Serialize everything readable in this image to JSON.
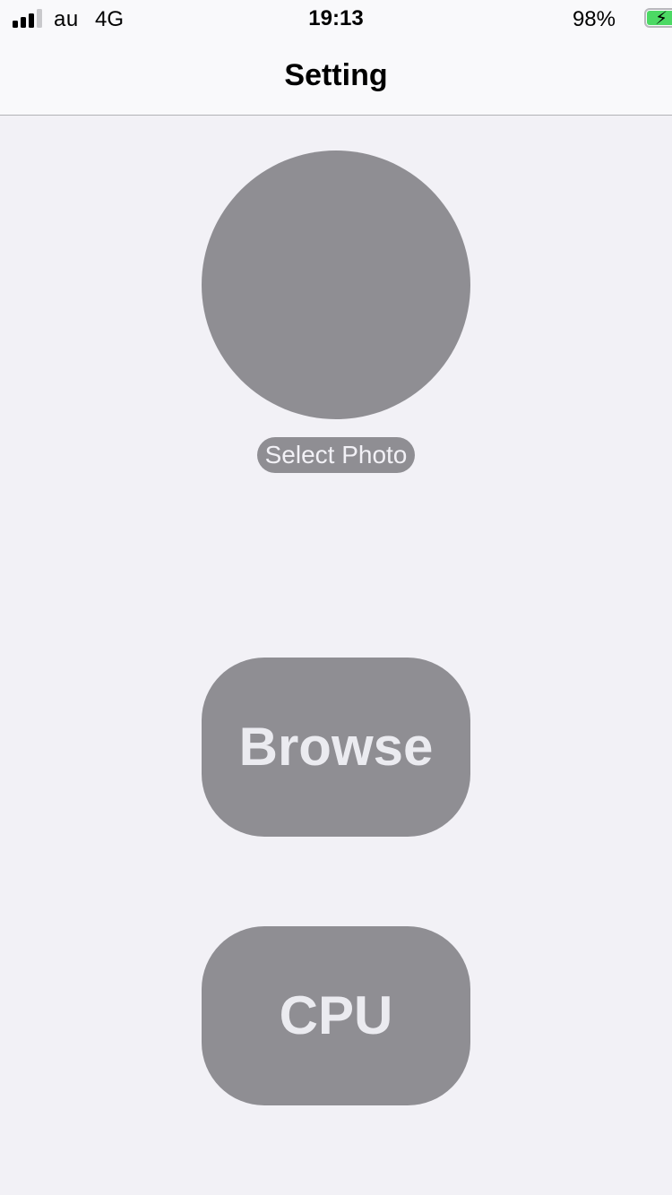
{
  "status_bar": {
    "carrier": "au",
    "network": "4G",
    "time": "19:13",
    "battery_percent": "98%",
    "battery_level": 0.98,
    "signal_bars_active": 3,
    "signal_bars_total": 4,
    "battery_color": "#4cd964"
  },
  "nav": {
    "title": "Setting"
  },
  "profile": {
    "select_photo_label": "Select Photo",
    "placeholder_color": "#8f8e93"
  },
  "actions": {
    "browse_label": "Browse",
    "cpu_label": "CPU",
    "button_color": "#8f8e93"
  },
  "colors": {
    "background": "#f2f1f6",
    "bar_background": "#f9f9fb"
  }
}
